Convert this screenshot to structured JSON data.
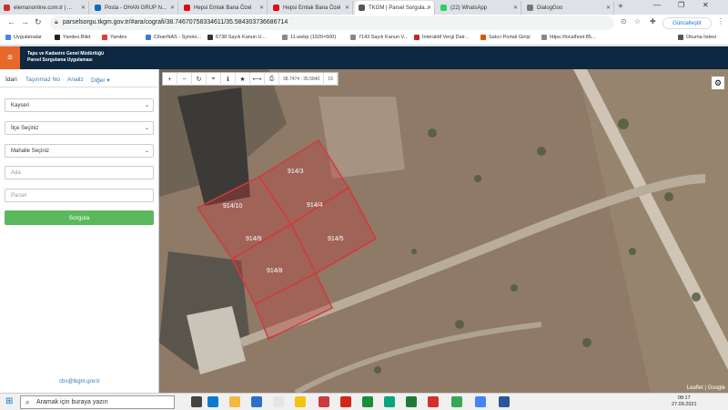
{
  "browser": {
    "tabs": [
      {
        "title": "elemanonline.com.tr | ...",
        "color": "#c9302c",
        "active": false
      },
      {
        "title": "Posta - OHAN GRUP N...",
        "color": "#0f6cbd",
        "active": false
      },
      {
        "title": "Hepsi Emlak Bana Özel",
        "color": "#e30613",
        "active": false
      },
      {
        "title": "Hepsi Emlak Bana Özel",
        "color": "#e30613",
        "active": false
      },
      {
        "title": "TKGM | Parsel Sorgula...",
        "color": "#555555",
        "active": true
      },
      {
        "title": "(22) WhatsApp",
        "color": "#25d366",
        "active": false
      },
      {
        "title": "DialogGoo",
        "color": "#777777",
        "active": false
      }
    ],
    "url": "parselsorgu.tkgm.gov.tr/#ara/cografi/38.74670758334611/35.584303736686714",
    "update_label": "Güncelleştir",
    "bookmarks": [
      {
        "label": "Uygulamalar",
        "color": "#4285f4"
      },
      {
        "label": "Yandex.Bilet",
        "color": "#222"
      },
      {
        "label": "Yandex",
        "color": "#e53935"
      },
      {
        "label": "CihanNAS - Synolo...",
        "color": "#3a7bd5"
      },
      {
        "label": "6738 Sayılı Kanun U...",
        "color": "#333"
      },
      {
        "label": "11.webp (1920×600)",
        "color": "#888"
      },
      {
        "label": "7143 Sayılı Kanun V...",
        "color": "#888"
      },
      {
        "label": "İnteraktif Vergi Dair...",
        "color": "#c62828"
      },
      {
        "label": "Satıcı Portalı Girişi",
        "color": "#e65100"
      },
      {
        "label": "https://localhost:85...",
        "color": "#888"
      }
    ],
    "reading_list": "Okuma listesi"
  },
  "app": {
    "title_line1": "Tapu ve Kadastro Genel Müdürlüğü",
    "title_line2": "Parsel Sorgulama Uygulaması",
    "tabs": [
      "İdari",
      "Taşınmaz No",
      "Analiz",
      "Diğer"
    ],
    "province": "Kayseri",
    "district_placeholder": "İlçe Seçiniz",
    "neighborhood_placeholder": "Mahalle Seçiniz",
    "block_placeholder": "Ada",
    "parcel_placeholder": "Parsel",
    "query_label": "Sorgula",
    "email": "cbs@tkgm.gov.tr"
  },
  "map": {
    "coordinate": "38.7474 : 35.5840",
    "zoom": "19",
    "attribution": "Leaflet | Google",
    "parcels": [
      "914/3",
      "914/10",
      "914/4",
      "914/9",
      "914/5",
      "914/8"
    ]
  },
  "taskbar": {
    "search_placeholder": "Aramak için buraya yazın",
    "time": "08:17",
    "date": "27.09.2021"
  }
}
